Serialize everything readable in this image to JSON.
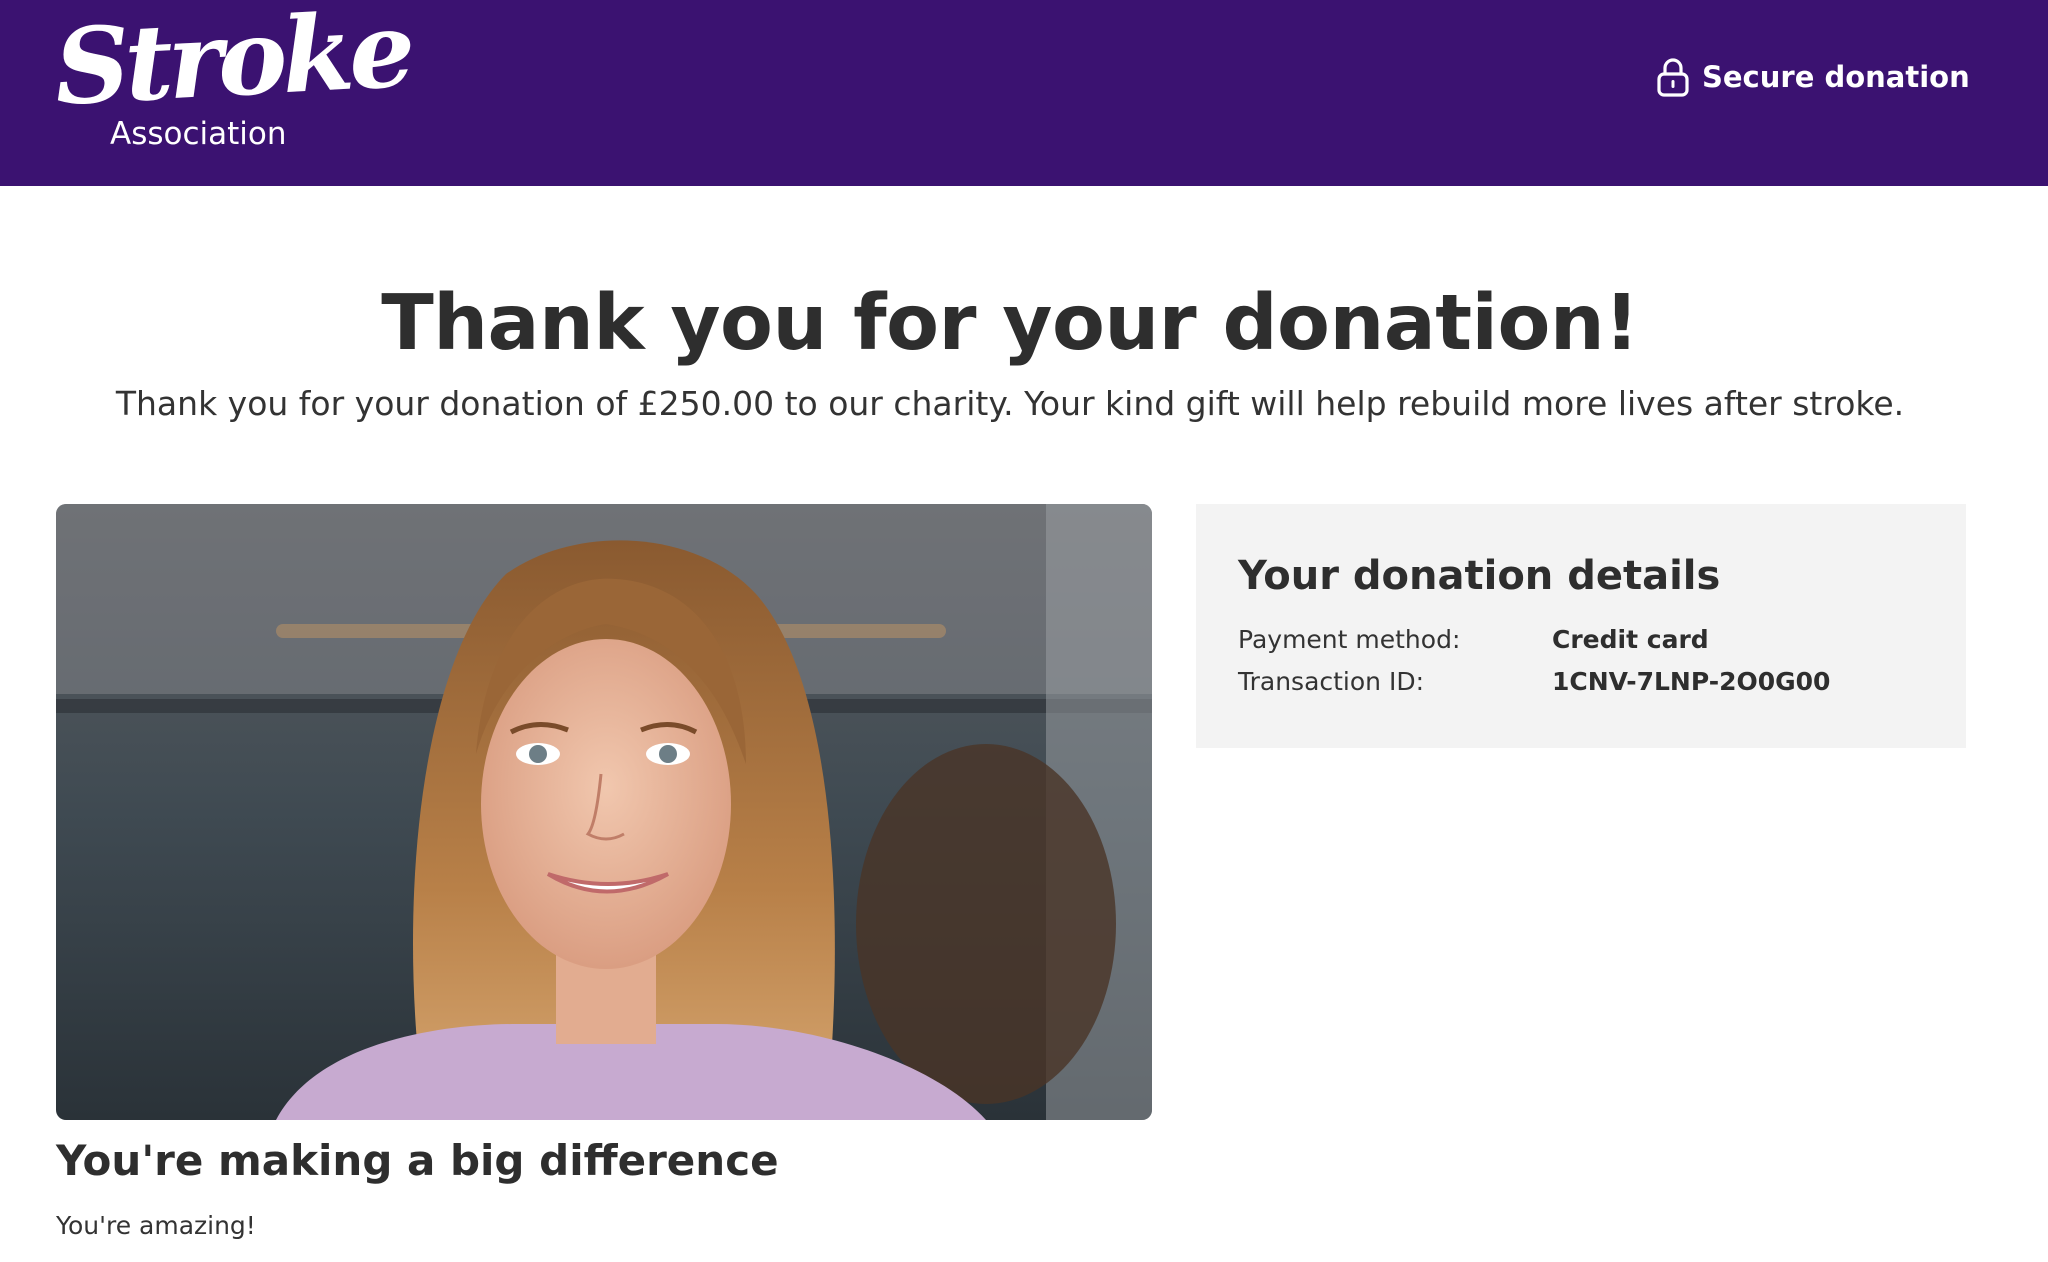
{
  "header": {
    "logo_word": "Stroke",
    "logo_sub": "Association",
    "secure_label": "Secure donation",
    "secure_icon": "lock-icon",
    "background_color": "#3b1271"
  },
  "main": {
    "title": "Thank you for your donation!",
    "intro": "Thank you for your donation of £250.00 to our charity. Your kind gift will help rebuild more lives after stroke."
  },
  "card": {
    "heading": "You're making a big difference",
    "text": "You're amazing!"
  },
  "details": {
    "title": "Your donation details",
    "rows": [
      {
        "label": "Payment method:",
        "value": "Credit card"
      },
      {
        "label": "Transaction ID:",
        "value": "1CNV-7LNP-2O0G00"
      }
    ]
  }
}
